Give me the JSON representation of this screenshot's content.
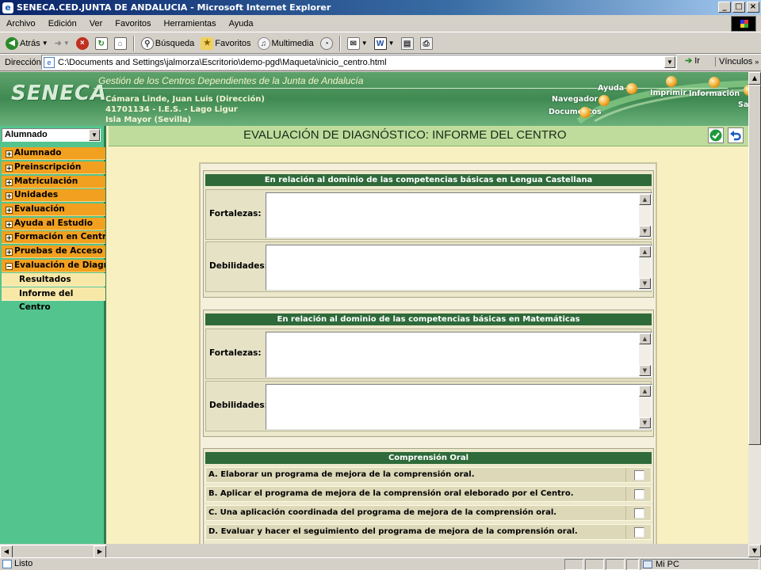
{
  "window": {
    "title": "SENECA.CED.JUNTA DE ANDALUCIA - Microsoft Internet Explorer"
  },
  "menubar": [
    "Archivo",
    "Edición",
    "Ver",
    "Favoritos",
    "Herramientas",
    "Ayuda"
  ],
  "toolbar": {
    "back": "Atrás",
    "search": "Búsqueda",
    "favorites": "Favoritos",
    "media": "Multimedia"
  },
  "address": {
    "label": "Dirección",
    "url": "C:\\Documents and Settings\\jalmorza\\Escritorio\\demo-pgd\\Maqueta\\inicio_centro.html",
    "go": "Ir",
    "links": "Vínculos"
  },
  "header": {
    "logo": "SENECA",
    "title": "Gestión de los Centros Dependientes de  la Junta de Andalucía",
    "user": "Cámara Linde, Juan Luis (Dirección)",
    "center": "41701134 - I.E.S. - Lago Ligur",
    "location": "Isla Mayor (Sevilla)",
    "nav": {
      "help": "Ayuda",
      "print": "Imprimir",
      "info": "Información",
      "navigator": "Navegador",
      "exit": "Salir",
      "documents": "Documentos"
    }
  },
  "sidebar": {
    "selector": "Alumnado",
    "items": [
      {
        "label": "Alumnado",
        "sign": "+"
      },
      {
        "label": "Preinscripción",
        "sign": "+"
      },
      {
        "label": "Matriculación",
        "sign": "+"
      },
      {
        "label": "Unidades",
        "sign": "+"
      },
      {
        "label": "Evaluación",
        "sign": "+"
      },
      {
        "label": "Ayuda al Estudio",
        "sign": "+"
      },
      {
        "label": "Formación en Centros",
        "sign": "+"
      },
      {
        "label": "Pruebas de Acceso",
        "sign": "+"
      },
      {
        "label": "Evaluación de Diagnós",
        "sign": "−"
      }
    ],
    "subitems": [
      "Resultados pruebas",
      "Informe del Centro"
    ]
  },
  "page": {
    "title": "EVALUACIÓN DE DIAGNÓSTICO: INFORME DEL CENTRO"
  },
  "sections": [
    {
      "heading": "En relación al dominio de las competencias básicas en Lengua Castellana",
      "strengths": "Fortalezas:",
      "weaknesses": "Debilidades:"
    },
    {
      "heading": "En relación al dominio de las competencias básicas en Matemáticas",
      "strengths": "Fortalezas:",
      "weaknesses": "Debilidades:"
    }
  ],
  "oral": {
    "heading": "Comprensión Oral",
    "options": [
      "A. Elaborar un programa de mejora de la comprensión oral.",
      "B. Aplicar el programa de mejora de la comprensión oral eleborado por el Centro.",
      "C. Una aplicación coordinada del programa de mejora de la comprensión oral.",
      "D. Evaluar y hacer el seguimiento del programa de mejora de la comprensión oral."
    ]
  },
  "status": {
    "text": "Listo",
    "zone": "Mi PC"
  }
}
